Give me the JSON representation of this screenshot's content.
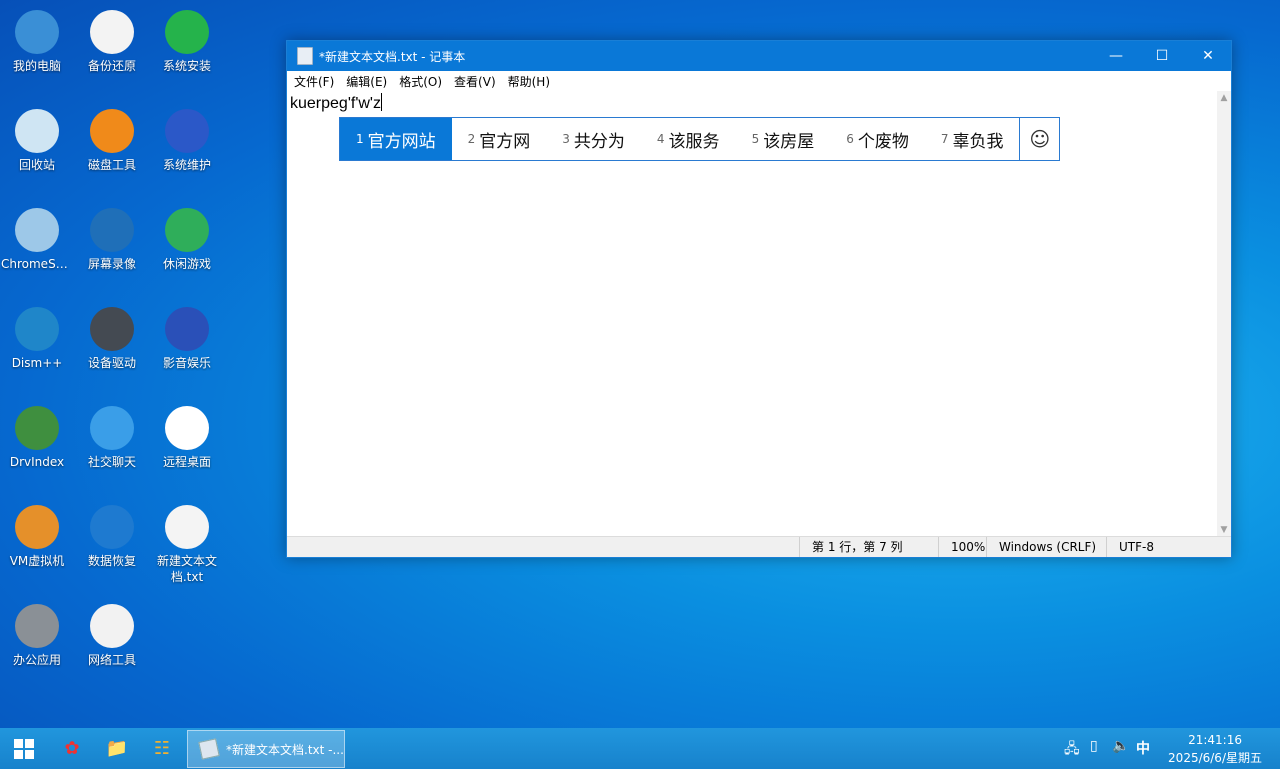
{
  "desktop": {
    "icons": [
      {
        "label": "我的电脑",
        "icon": "computer-icon",
        "color": "#3a8fd6"
      },
      {
        "label": "备份还原",
        "icon": "backup-icon",
        "color": "#f3f3f3"
      },
      {
        "label": "系统安装",
        "icon": "install-icon",
        "color": "#25b34b"
      },
      {
        "label": "回收站",
        "icon": "recycle-bin-icon",
        "color": "#cfe5f3"
      },
      {
        "label": "磁盘工具",
        "icon": "disk-tool-icon",
        "color": "#f08a1a"
      },
      {
        "label": "系统维护",
        "icon": "maintenance-icon",
        "color": "#2b58c8"
      },
      {
        "label": "ChromeSe...",
        "icon": "chrome-setup-icon",
        "color": "#9dc8e8"
      },
      {
        "label": "屏幕录像",
        "icon": "camera-icon",
        "color": "#1f6fb8"
      },
      {
        "label": "休闲游戏",
        "icon": "game-icon",
        "color": "#2fae5a"
      },
      {
        "label": "Dism++",
        "icon": "gears-icon",
        "color": "#1f86c9"
      },
      {
        "label": "设备驱动",
        "icon": "driver-icon",
        "color": "#444a52"
      },
      {
        "label": "影音娱乐",
        "icon": "media-icon",
        "color": "#2a50b8"
      },
      {
        "label": "DrvIndex",
        "icon": "network-card-icon",
        "color": "#3f8f3f"
      },
      {
        "label": "社交聊天",
        "icon": "finder-icon",
        "color": "#3a9ee8"
      },
      {
        "label": "远程桌面",
        "icon": "remote-desktop-icon",
        "color": "#ffffff"
      },
      {
        "label": "VM虚拟机",
        "icon": "vm-icon",
        "color": "#e5902a"
      },
      {
        "label": "数据恢复",
        "icon": "data-recovery-icon",
        "color": "#1e7ad0"
      },
      {
        "label": "新建文本文档.txt",
        "icon": "text-file-icon",
        "color": "#f4f4f4"
      },
      {
        "label": "办公应用",
        "icon": "office-icon",
        "color": "#8a9096"
      },
      {
        "label": "网络工具",
        "icon": "cloud-key-icon",
        "color": "#f2f2f2"
      }
    ]
  },
  "notepad": {
    "title": "*新建文本文档.txt - 记事本",
    "menu": [
      "文件(F)",
      "编辑(E)",
      "格式(O)",
      "查看(V)",
      "帮助(H)"
    ],
    "content": "kuerpeg'f'w'z",
    "status": {
      "position": "第 1 行，第 7 列",
      "zoom": "100%",
      "line_ending": "Windows (CRLF)",
      "encoding": "UTF-8"
    }
  },
  "ime": {
    "candidates": [
      {
        "num": "1",
        "text": "官方网站"
      },
      {
        "num": "2",
        "text": "官方网"
      },
      {
        "num": "3",
        "text": "共分为"
      },
      {
        "num": "4",
        "text": "该服务"
      },
      {
        "num": "5",
        "text": "该房屋"
      },
      {
        "num": "6",
        "text": "个废物"
      },
      {
        "num": "7",
        "text": "辜负我"
      }
    ],
    "selected_index": 0,
    "emoji_symbol": "☺"
  },
  "taskbar": {
    "task_label": "*新建文本文档.txt -...",
    "ime_indicator": "中",
    "time": "21:41:16",
    "date": "2025/6/6/星期五"
  },
  "colors": {
    "accent": "#0a78d7"
  }
}
